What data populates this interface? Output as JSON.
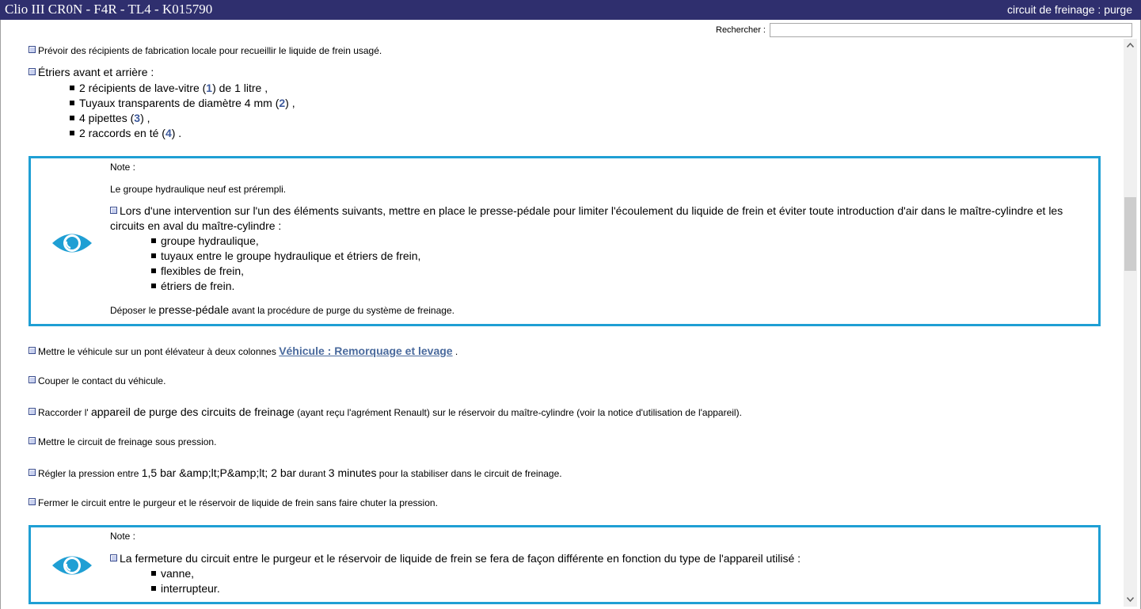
{
  "window": {
    "title": "Clio III CR0N - F4R - TL4 - K015790",
    "section": "circuit de freinage : purge"
  },
  "search": {
    "label": "Rechercher :",
    "value": ""
  },
  "intro": {
    "prepare": "Prévoir des récipients de fabrication locale pour recueillir le liquide de frein usagé.",
    "calipers_title": "Étriers avant et arrière :",
    "items": [
      {
        "pre": "2 récipients de lave-vitre (",
        "num": "1",
        "post": ") de 1 litre ,"
      },
      {
        "pre": "Tuyaux transparents de diamètre 4 mm (",
        "num": "2",
        "post": ") ,"
      },
      {
        "pre": "4 pipettes (",
        "num": "3",
        "post": ") ,"
      },
      {
        "pre": "2 raccords en té (",
        "num": "4",
        "post": ") ."
      }
    ]
  },
  "note1": {
    "label": "Note :",
    "line1": "Le groupe hydraulique neuf est prérempli.",
    "line2a": "Lors d'une intervention sur l'un des éléments suivants, mettre en place le presse-pédale pour limiter l'écoulement du liquide de frein et éviter toute introduction d'air dans le maître-cylindre et les",
    "line2b": "circuits en aval du maître-cylindre :",
    "items": [
      "groupe hydraulique,",
      "tuyaux entre le groupe hydraulique et étriers de frein,",
      "flexibles de frein,",
      "étriers de frein."
    ],
    "line3a": "Déposer le ",
    "line3b": "presse-pédale",
    "line3c": " avant la procédure de purge du système de freinage."
  },
  "steps": {
    "lift": "Mettre le véhicule sur un pont élévateur à deux colonnes ",
    "lift_link": "Véhicule : Remorquage et levage",
    "lift_end": " .",
    "ignition": "Couper le contact du véhicule.",
    "connect_a": "Raccorder l' ",
    "connect_b": "appareil de purge des circuits de freinage",
    "connect_c": " (ayant reçu l'agrément Renault) sur le réservoir du maître-cylindre (voir la notice d'utilisation de l'appareil).",
    "pressure": "Mettre le circuit de freinage sous pression.",
    "regulate_a": "Régler la pression entre ",
    "regulate_b": "1,5 bar &amp;lt;P&amp;lt; 2 bar",
    "regulate_c": " durant ",
    "regulate_d": "3 minutes",
    "regulate_e": " pour la stabiliser dans le circuit de freinage.",
    "close": "Fermer le circuit entre le purgeur et le réservoir de liquide de frein sans faire chuter la pression."
  },
  "note2": {
    "label": "Note :",
    "line1": "La fermeture du circuit entre le purgeur et le réservoir de liquide de frein se fera de façon différente en fonction du type de l'appareil utilisé :",
    "items": [
      "vanne,",
      "interrupteur."
    ]
  },
  "colors": {
    "titlebar": "#2f2f6e",
    "note_border": "#1f9fd4",
    "link": "#4a6a9d",
    "ref_number": "#3f5b9d"
  },
  "icons": {
    "note": "eye-icon",
    "bullet": "square-bullet-icon"
  }
}
